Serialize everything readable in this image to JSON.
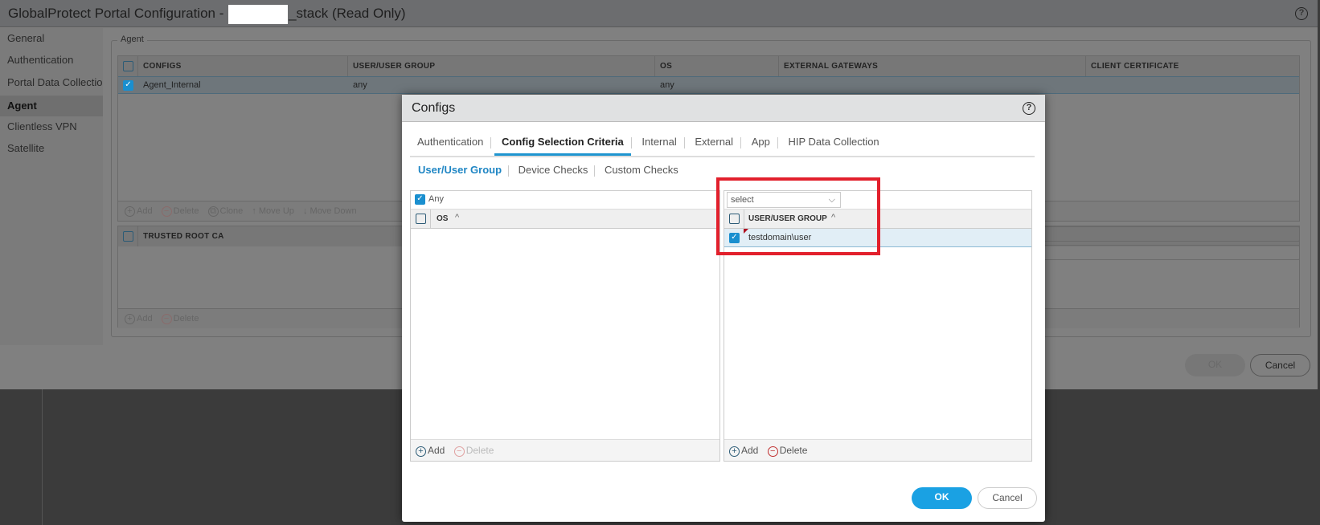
{
  "outer": {
    "title_prefix": "GlobalProtect Portal Configuration - ",
    "title_suffix": "_stack (Read Only)",
    "nav": [
      "General",
      "Authentication",
      "Portal Data Collectio",
      "Agent",
      "Clientless VPN",
      "Satellite"
    ],
    "selected_nav": "Agent",
    "agent_legend": "Agent",
    "configs_table": {
      "columns": [
        "CONFIGS",
        "USER/USER GROUP",
        "OS",
        "EXTERNAL GATEWAYS",
        "CLIENT CERTIFICATE"
      ],
      "rows": [
        {
          "checked": true,
          "cells": [
            "Agent_Internal",
            "any",
            "any",
            "",
            ""
          ]
        }
      ],
      "toolbar": [
        "Add",
        "Delete",
        "Clone",
        "Move Up",
        "Move Down"
      ]
    },
    "trusted_table": {
      "columns": [
        "TRUSTED ROOT CA"
      ],
      "toolbar": [
        "Add",
        "Delete"
      ]
    },
    "ok": "OK",
    "cancel": "Cancel"
  },
  "dialog": {
    "title": "Configs",
    "tabs": [
      "Authentication",
      "Config Selection Criteria",
      "Internal",
      "External",
      "App",
      "HIP Data Collection"
    ],
    "selected_tab": "Config Selection Criteria",
    "subtabs": [
      "User/User Group",
      "Device Checks",
      "Custom Checks"
    ],
    "selected_subtab": "User/User Group",
    "os_panel": {
      "any_label": "Any",
      "any_checked": true,
      "column": "OS",
      "toolbar": [
        "Add",
        "Delete"
      ]
    },
    "user_panel": {
      "select_value": "select",
      "column": "USER/USER GROUP",
      "rows": [
        {
          "checked": true,
          "value": "testdomain\\user"
        }
      ],
      "toolbar": [
        "Add",
        "Delete"
      ]
    },
    "ok": "OK",
    "cancel": "Cancel"
  },
  "colors": {
    "accent": "#1f95d0",
    "highlight": "#e2202c"
  }
}
